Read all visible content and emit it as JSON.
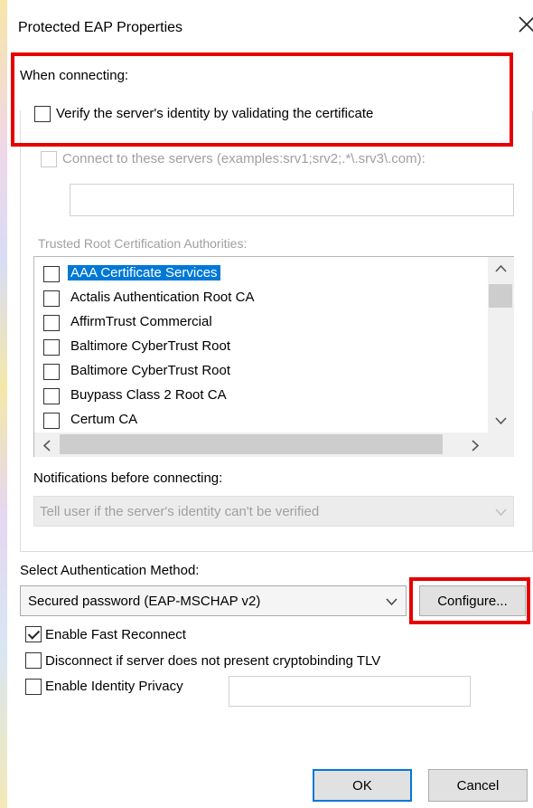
{
  "window": {
    "title": "Protected EAP Properties",
    "close_icon": "close-icon"
  },
  "when_connecting": {
    "label": "When connecting:",
    "verify_label": "Verify the server's identity by validating the certificate",
    "verify_checked": false,
    "connect_servers_label": "Connect to these servers (examples:srv1;srv2;.*\\.srv3\\.com):",
    "servers_value": "",
    "trusted_root_label": "Trusted Root Certification Authorities:",
    "authorities": [
      {
        "name": "AAA Certificate Services",
        "checked": false,
        "selected": true
      },
      {
        "name": "Actalis Authentication Root CA",
        "checked": false,
        "selected": false
      },
      {
        "name": "AffirmTrust Commercial",
        "checked": false,
        "selected": false
      },
      {
        "name": "Baltimore CyberTrust Root",
        "checked": false,
        "selected": false
      },
      {
        "name": "Baltimore CyberTrust Root",
        "checked": false,
        "selected": false
      },
      {
        "name": "Buypass Class 2 Root CA",
        "checked": false,
        "selected": false
      },
      {
        "name": "Certum CA",
        "checked": false,
        "selected": false
      }
    ],
    "notifications_label": "Notifications before connecting:",
    "notifications_value": "Tell user if the server's identity can't be verified"
  },
  "auth": {
    "label": "Select Authentication Method:",
    "method_value": "Secured password (EAP-MSCHAP v2)",
    "configure_label": "Configure...",
    "fast_reconnect_label": "Enable Fast Reconnect",
    "fast_reconnect_checked": true,
    "cryptobinding_label": "Disconnect if server does not present cryptobinding TLV",
    "cryptobinding_checked": false,
    "identity_privacy_label": "Enable Identity Privacy",
    "identity_privacy_checked": false,
    "identity_value": ""
  },
  "footer": {
    "ok_label": "OK",
    "cancel_label": "Cancel"
  },
  "colors": {
    "highlight_red": "#e60000",
    "selection_blue": "#0078d7"
  }
}
